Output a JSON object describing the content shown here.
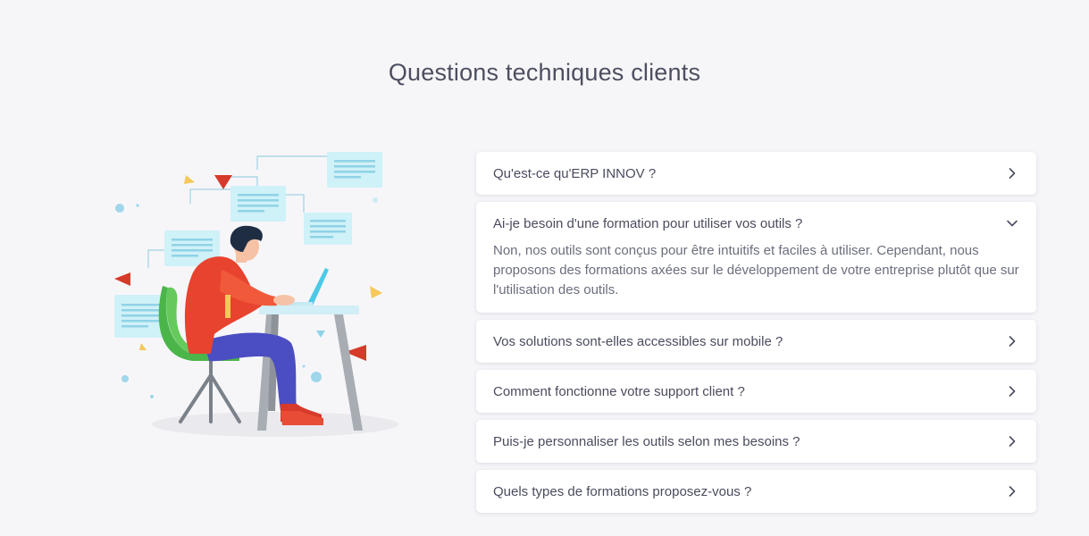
{
  "section": {
    "title": "Questions techniques clients"
  },
  "illustration": {
    "description_icon": "person-at-laptop-icon"
  },
  "faq": [
    {
      "question": "Qu'est-ce qu'ERP INNOV ?",
      "expanded": false,
      "icon": "chevron-right-icon"
    },
    {
      "question": "Ai-je besoin d'une formation pour utiliser vos outils ?",
      "expanded": true,
      "icon": "chevron-down-icon",
      "answer": "Non, nos outils sont conçus pour être intuitifs et faciles à utiliser. Cependant, nous proposons des formations axées sur le développement de votre entreprise plutôt que sur l'utilisation des outils."
    },
    {
      "question": "Vos solutions sont-elles accessibles sur mobile ?",
      "expanded": false,
      "icon": "chevron-right-icon"
    },
    {
      "question": "Comment fonctionne votre support client ?",
      "expanded": false,
      "icon": "chevron-right-icon"
    },
    {
      "question": "Puis-je personnaliser les outils selon mes besoins ?",
      "expanded": false,
      "icon": "chevron-right-icon"
    },
    {
      "question": "Quels types de formations proposez-vous ?",
      "expanded": false,
      "icon": "chevron-right-icon"
    }
  ],
  "colors": {
    "background": "#f6f6f9",
    "card": "#ffffff",
    "text": "#4a4c5e"
  }
}
